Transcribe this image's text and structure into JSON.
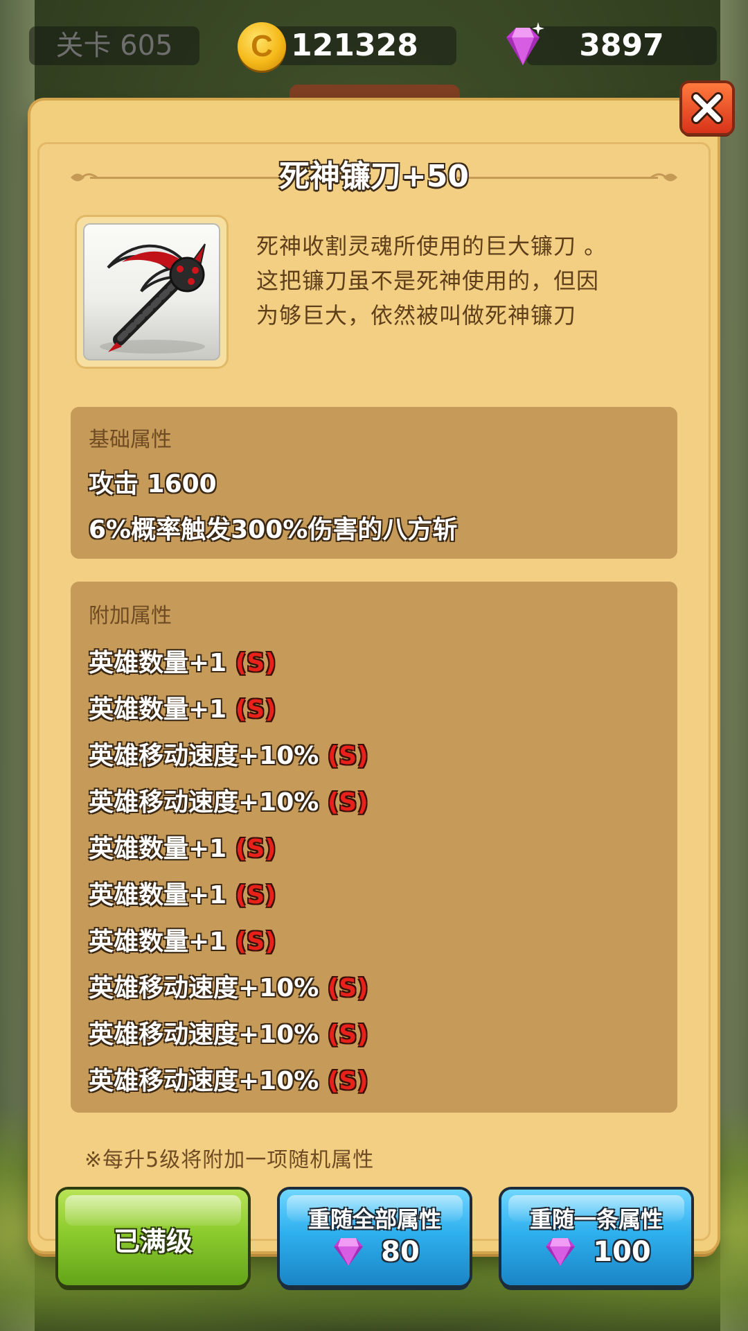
{
  "topbar": {
    "level_label": "关卡 605",
    "coin_symbol": "C",
    "coins": "121328",
    "gems": "3897"
  },
  "item": {
    "title": "死神镰刀+50",
    "icon": "scythe-icon",
    "description": [
      "死神收割灵魂所使用的巨大镰刀 。",
      "这把镰刀虽不是死神使用的，但因",
      "为够巨大，依然被叫做死神镰刀"
    ]
  },
  "base_attributes": {
    "label": "基础属性",
    "stats": [
      "攻击 1600",
      "6%概率触发300%伤害的八方斩"
    ]
  },
  "extra_attributes": {
    "label": "附加属性",
    "grade_text": "(S)",
    "stats": [
      "英雄数量+1",
      "英雄数量+1",
      "英雄移动速度+10%",
      "英雄移动速度+10%",
      "英雄数量+1",
      "英雄数量+1",
      "英雄数量+1",
      "英雄移动速度+10%",
      "英雄移动速度+10%",
      "英雄移动速度+10%"
    ]
  },
  "note": "※每升5级将附加一项随机属性",
  "buttons": {
    "max_level": "已满级",
    "reroll_all": {
      "label": "重随全部属性",
      "cost": "80"
    },
    "reroll_one": {
      "label": "重随一条属性",
      "cost": "100"
    }
  },
  "colors": {
    "panel": "#f3cf84",
    "attr_box": "#c69a58",
    "grade_red": "#e8221a",
    "green_button": "#8ccb2d",
    "blue_button": "#2fb0ee",
    "gem": "#d64bdc"
  }
}
